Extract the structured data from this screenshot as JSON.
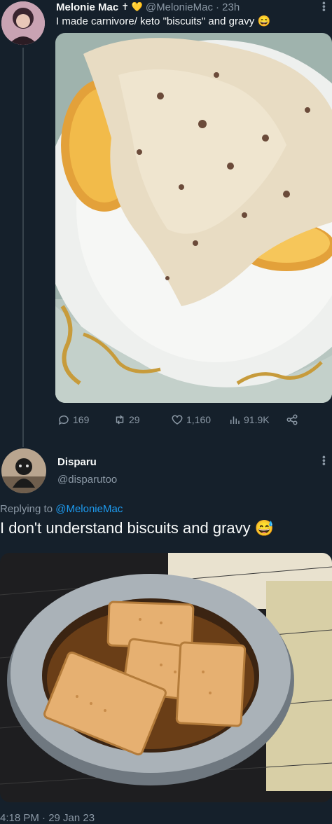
{
  "tweet1": {
    "name": "Melonie Mac",
    "badges": "✝ 💛",
    "handle": "@MelonieMac",
    "time": "· 23h",
    "text": "I made carnivore/ keto \"biscuits\" and gravy 😄",
    "image_desc_icon": "food-photo-icon",
    "actions": {
      "replies": "169",
      "retweets": "29",
      "likes": "1,160",
      "views": "91.9K"
    }
  },
  "tweet2": {
    "name": "Disparu",
    "handle": "@disparutoo",
    "replying_prefix": "Replying to",
    "replying_to": "@MelonieMac",
    "text": "I don't understand biscuits and gravy 😅",
    "timestamp": "4:18 PM · 29 Jan 23"
  },
  "colors": {
    "background": "#15202b",
    "text": "#f7f9f9",
    "muted": "#8b98a5",
    "link": "#1d9bf0"
  }
}
